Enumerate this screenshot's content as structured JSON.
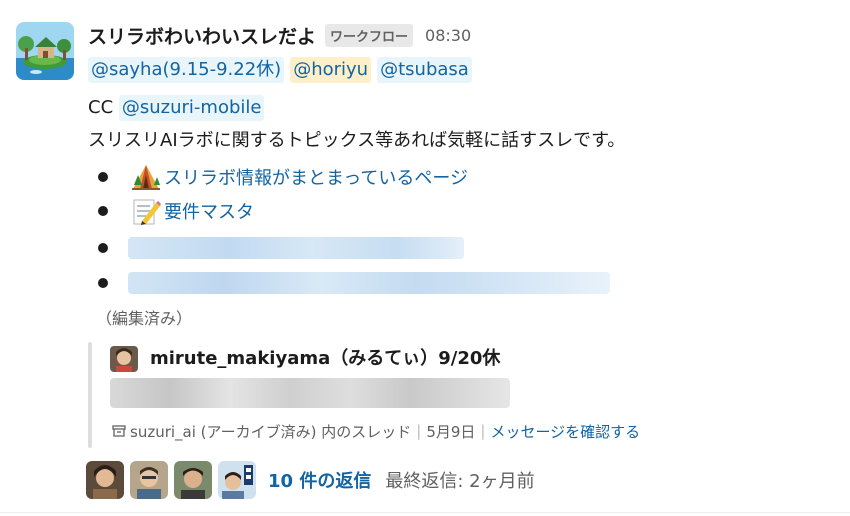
{
  "message": {
    "sender": "スリラボわいわいスレだよ",
    "badge": "ワークフロー",
    "time": "08:30",
    "mentions": [
      "@sayha(9.15-9.22休)",
      "@horiyu",
      "@tsubasa"
    ],
    "cc_prefix": "CC",
    "cc_mention": "@suzuri-mobile",
    "description": "スリスリAIラボに関するトピックス等あれば気軽に話すスレです。",
    "bullets": [
      {
        "emoji": "tent-icon",
        "label": "スリラボ情報がまとまっているページ"
      },
      {
        "emoji": "memo-icon",
        "label": "要件マスタ"
      }
    ],
    "edited": "（編集済み）"
  },
  "quoted": {
    "author": "mirute_makiyama（みるてぃ）9/20休",
    "channel_text": "suzuri_ai (アーカイブ済み) 内のスレッド",
    "date": "5月9日",
    "view_link": "メッセージを確認する"
  },
  "thread": {
    "reply_count": "10 件の返信",
    "last_reply": "最終返信: 2ヶ月前"
  },
  "colors": {
    "link": "#1264a3",
    "mention_bg": "#e8f5fa",
    "self_mention_bg": "#fdefc8",
    "muted": "#616061"
  }
}
